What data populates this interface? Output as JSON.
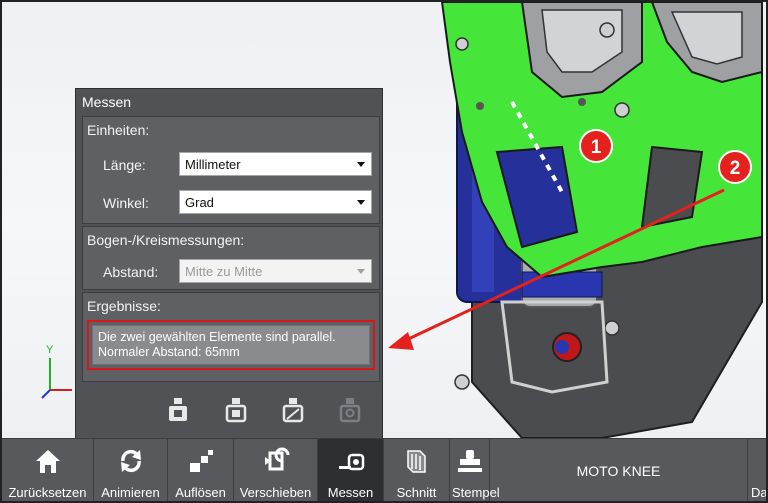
{
  "panel": {
    "title": "Messen",
    "units": {
      "header": "Einheiten:",
      "length_label": "Länge:",
      "length_value": "Millimeter",
      "angle_label": "Winkel:",
      "angle_value": "Grad"
    },
    "arc": {
      "header": "Bogen-/Kreismessungen:",
      "distance_label": "Abstand:",
      "distance_value": "Mitte zu Mitte"
    },
    "results": {
      "header": "Ergebnisse:",
      "line1": "Die zwei gewählten Elemente sind parallel.",
      "line2": "Normaler Abstand: 65mm"
    }
  },
  "callouts": [
    "1",
    "2"
  ],
  "axes": {
    "y": "Y",
    "x": "X"
  },
  "toolbar": {
    "buttons": [
      {
        "label": "Zurücksetzen",
        "icon": "home-icon"
      },
      {
        "label": "Animieren",
        "icon": "rotate-icon"
      },
      {
        "label": "Auflösen",
        "icon": "explode-icon"
      },
      {
        "label": "Verschieben",
        "icon": "move-icon"
      },
      {
        "label": "Messen",
        "icon": "measure-icon",
        "active": true
      },
      {
        "label": "Schnitt",
        "icon": "section-icon"
      },
      {
        "label": "Stempel",
        "icon": "stamp-icon"
      }
    ],
    "title": "MOTO KNEE",
    "truncated": "Da"
  },
  "colors": {
    "accent_red": "#e4211d",
    "part_green": "#45e53a",
    "panel_bg": "#505256",
    "toolbar_bg": "#57595c"
  }
}
